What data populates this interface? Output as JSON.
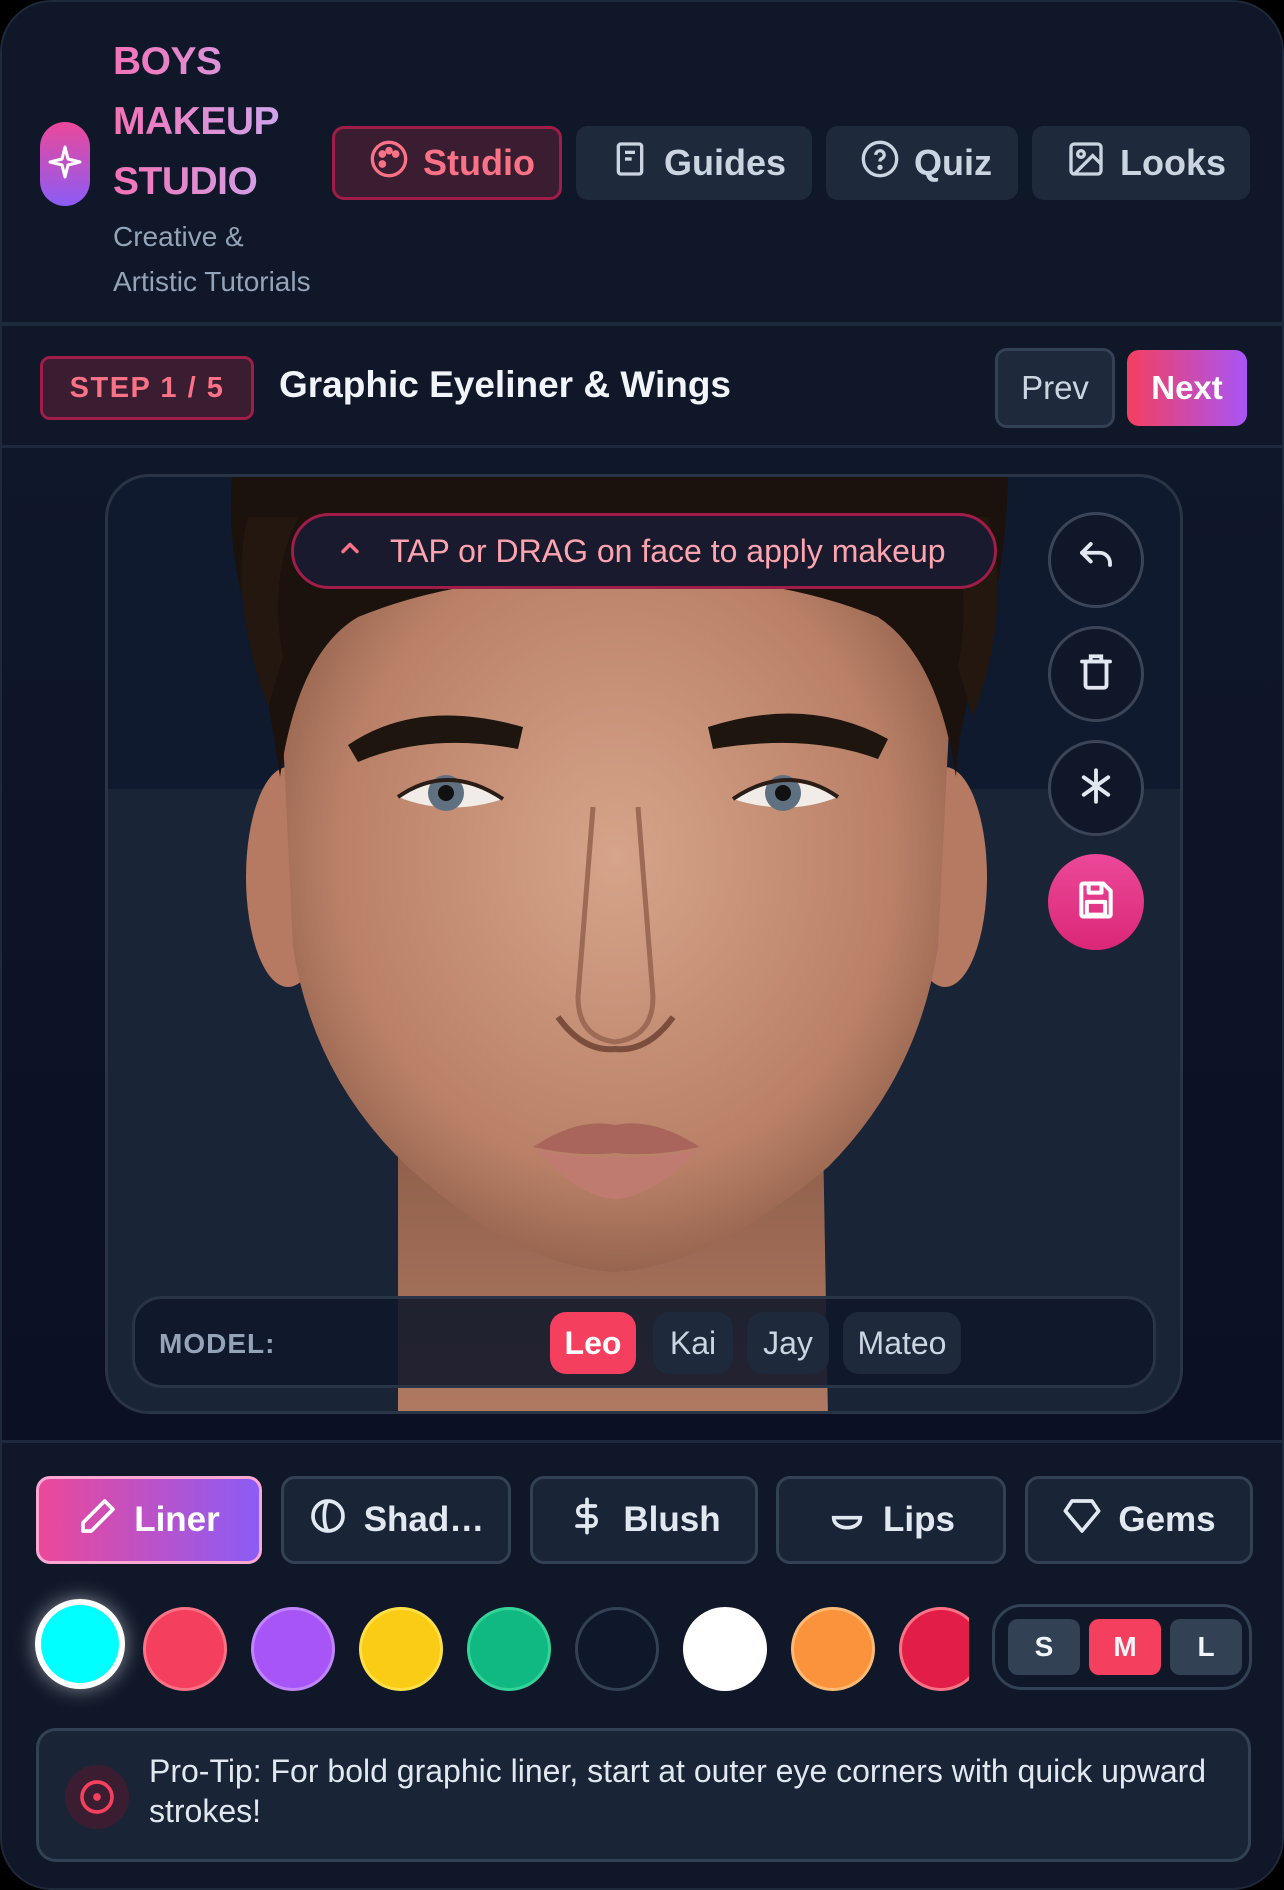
{
  "header": {
    "brand_title": "BOYS MAKEUP STUDIO",
    "brand_subtitle": "Creative & Artistic Tutorials",
    "nav": [
      {
        "label": "Studio",
        "icon": "palette-icon",
        "active": true
      },
      {
        "label": "Guides",
        "icon": "book-icon",
        "active": false
      },
      {
        "label": "Quiz",
        "icon": "help-circle-icon",
        "active": false
      },
      {
        "label": "Looks",
        "icon": "image-icon",
        "active": false
      }
    ]
  },
  "step": {
    "badge": "STEP 1 / 5",
    "title": "Graphic Eyeliner & Wings",
    "prev_label": "Prev",
    "next_label": "Next"
  },
  "canvas": {
    "hint": "TAP or DRAG on face to apply makeup",
    "tools": [
      "undo-icon",
      "trash-icon",
      "asterisk-icon",
      "save-icon"
    ],
    "model_label": "MODEL:",
    "models": [
      {
        "name": "Leo",
        "active": true
      },
      {
        "name": "Kai",
        "active": false
      },
      {
        "name": "Jay",
        "active": false
      },
      {
        "name": "Mateo",
        "active": false
      }
    ]
  },
  "categories": [
    {
      "label": "Liner",
      "icon": "pencil-icon",
      "active": true
    },
    {
      "label": "Shad…",
      "icon": "shadow-drop-icon",
      "active": false
    },
    {
      "label": "Blush",
      "icon": "dollar-icon",
      "active": false
    },
    {
      "label": "Lips",
      "icon": "lips-icon",
      "active": false
    },
    {
      "label": "Gems",
      "icon": "gem-icon",
      "active": false
    }
  ],
  "colors": [
    "#00ffff",
    "#f43f5e",
    "#a855f7",
    "#facc15",
    "#10b981",
    "#0f172a",
    "#ffffff",
    "#fb923c",
    "#e11d48"
  ],
  "selected_color": "#00ffff",
  "sizes": [
    {
      "label": "S",
      "active": false
    },
    {
      "label": "M",
      "active": true
    },
    {
      "label": "L",
      "active": false
    }
  ],
  "tip": "Pro-Tip: For bold graphic liner, start at outer eye corners with quick upward strokes!"
}
